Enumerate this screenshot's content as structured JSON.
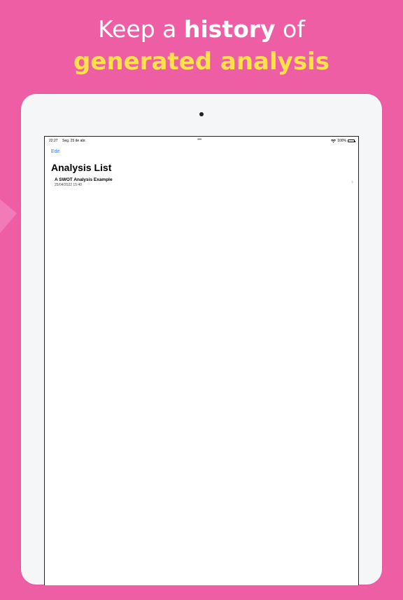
{
  "headline": {
    "line1_prefix": "Keep a ",
    "line1_bold": "history",
    "line1_suffix": " of",
    "line2": "generated analysis"
  },
  "status_bar": {
    "time": "22:27",
    "date": "Seg. 25 de abr.",
    "dots": "•••",
    "battery_text": "100%",
    "wifi_icon": "wifi-icon",
    "battery_icon": "battery-icon"
  },
  "nav": {
    "edit_label": "Edit",
    "title": "Analysis List"
  },
  "list": {
    "items": [
      {
        "title": "A SWOT Analysis Example",
        "date": "25/04/2022 15:40"
      }
    ],
    "chevron_glyph": "›"
  },
  "colors": {
    "background": "#ee5ea5",
    "headline_accent": "#ffe24a",
    "ios_link": "#2f7cf6"
  }
}
